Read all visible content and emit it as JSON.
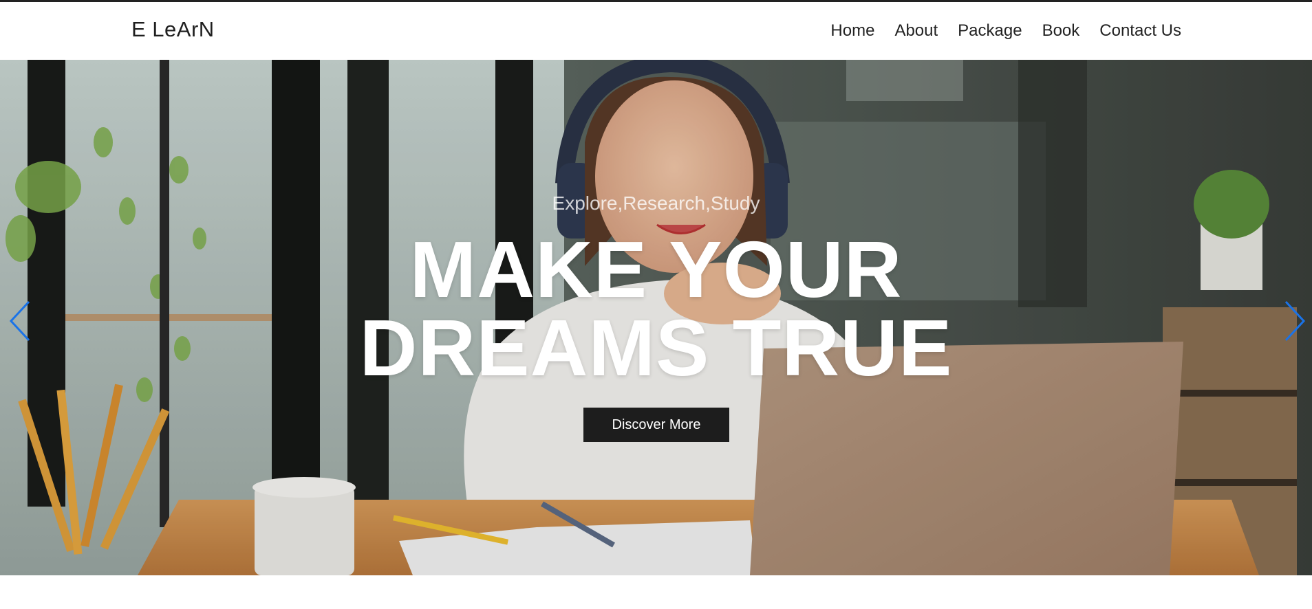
{
  "brand": {
    "name": "E LeArN"
  },
  "nav": {
    "items": [
      {
        "label": "Home"
      },
      {
        "label": "About"
      },
      {
        "label": "Package"
      },
      {
        "label": "Book"
      },
      {
        "label": "Contact Us"
      }
    ]
  },
  "hero": {
    "tagline": "Explore,Research,Study",
    "headline_line1": "MAKE YOUR",
    "headline_line2": "DREAMS TRUE",
    "cta_label": "Discover More",
    "prev_icon": "chevron-left-icon",
    "next_icon": "chevron-right-icon",
    "arrow_color": "#1a73e8"
  }
}
